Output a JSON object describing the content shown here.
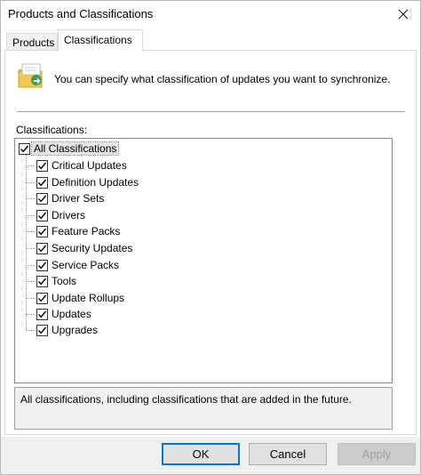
{
  "window": {
    "title": "Products and Classifications"
  },
  "tabs": [
    {
      "label": "Products",
      "selected": false
    },
    {
      "label": "Classifications",
      "selected": true
    }
  ],
  "intro": {
    "text": "You can specify what classification of updates you want to synchronize.",
    "icon": "folder-sync-icon"
  },
  "section_label": "Classifications:",
  "tree": {
    "root": {
      "label": "All Classifications",
      "checked": true
    },
    "items": [
      {
        "label": "Critical Updates",
        "checked": true
      },
      {
        "label": "Definition Updates",
        "checked": true
      },
      {
        "label": "Driver Sets",
        "checked": true
      },
      {
        "label": "Drivers",
        "checked": true
      },
      {
        "label": "Feature Packs",
        "checked": true
      },
      {
        "label": "Security Updates",
        "checked": true
      },
      {
        "label": "Service Packs",
        "checked": true
      },
      {
        "label": "Tools",
        "checked": true
      },
      {
        "label": "Update Rollups",
        "checked": true
      },
      {
        "label": "Updates",
        "checked": true
      },
      {
        "label": "Upgrades",
        "checked": true
      }
    ]
  },
  "description": "All classifications, including classifications that are added in the future.",
  "buttons": {
    "ok": "OK",
    "cancel": "Cancel",
    "apply": "Apply"
  },
  "colors": {
    "accent": "#0078d7",
    "folder": "#f2c94c"
  }
}
